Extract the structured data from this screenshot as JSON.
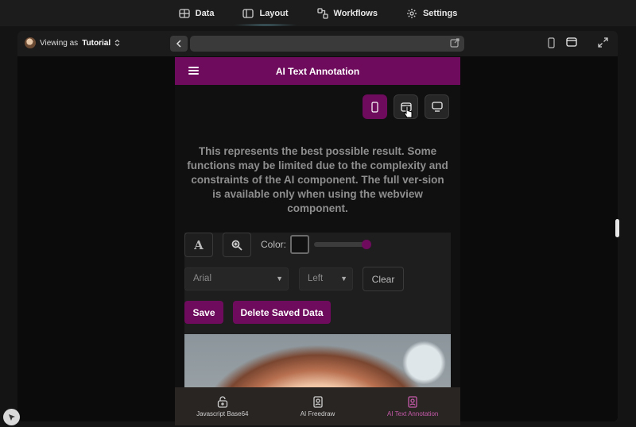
{
  "topnav": {
    "items": [
      {
        "label": "Data",
        "icon": "table-icon"
      },
      {
        "label": "Layout",
        "icon": "layout-icon",
        "active": true
      },
      {
        "label": "Workflows",
        "icon": "workflow-icon"
      },
      {
        "label": "Settings",
        "icon": "gear-icon"
      }
    ]
  },
  "toolbar": {
    "viewing_prefix": "Viewing as",
    "viewing_user": "Tutorial"
  },
  "app": {
    "title": "AI Text Annotation",
    "notice": "This represents the best possible result. Some functions may be limited due to the complexity and constraints of the AI component. The full ver-sion is available only when using the webview component.",
    "color_label": "Color:",
    "color_value": "#111111",
    "font_select": "Arial",
    "align_select": "Left",
    "clear_label": "Clear",
    "save_label": "Save",
    "delete_label": "Delete Saved Data"
  },
  "tabs": [
    {
      "label": "Javascript Base64",
      "icon": "unlock-icon"
    },
    {
      "label": "AI Freedraw",
      "icon": "portrait-icon"
    },
    {
      "label": "AI Text Annotation",
      "icon": "portrait-icon",
      "active": true
    }
  ],
  "colors": {
    "accent": "#6e0b5c",
    "accent_light": "#c45aa8",
    "background": "#141414"
  }
}
